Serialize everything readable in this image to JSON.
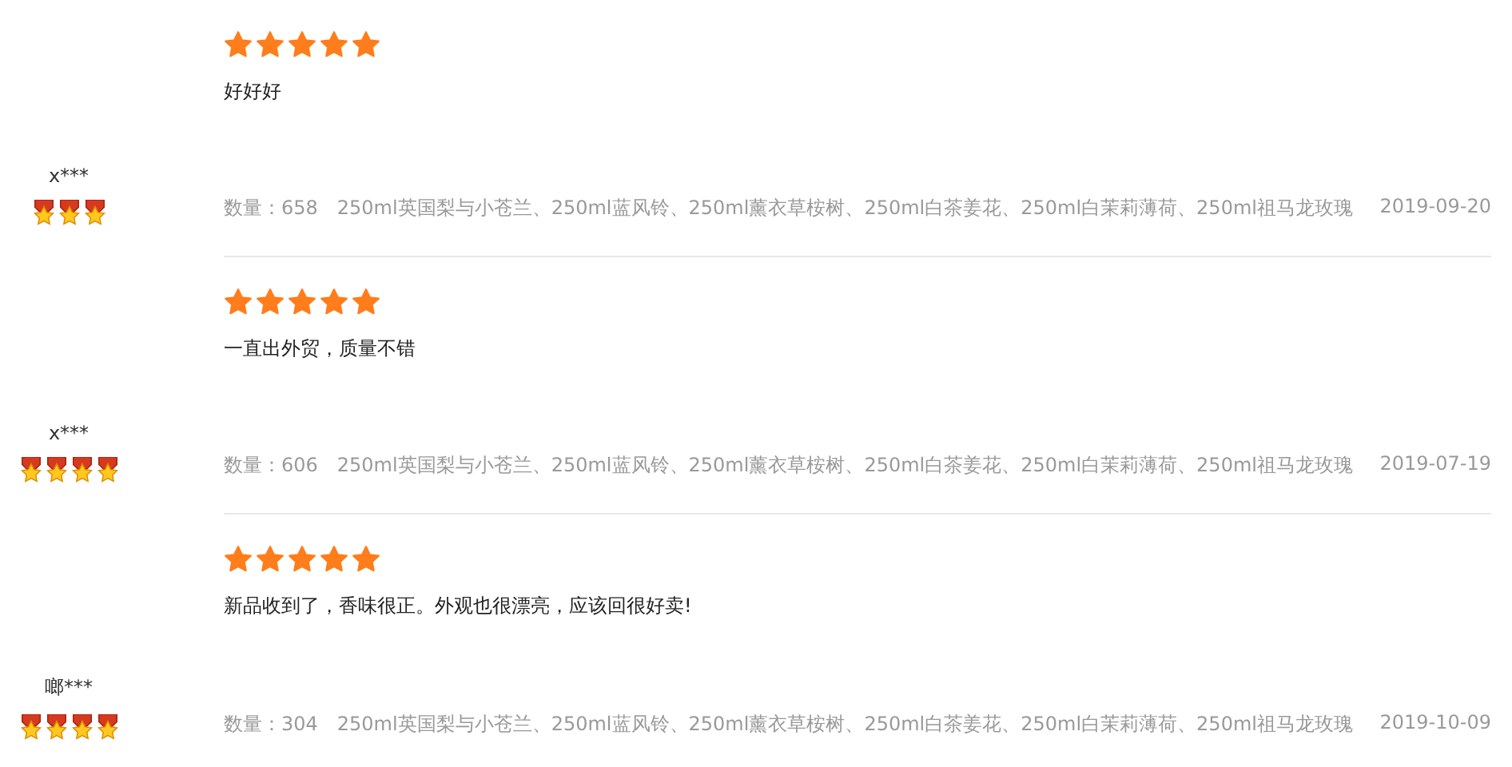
{
  "reviews": [
    {
      "user": {
        "name": "x***",
        "stars": 3
      },
      "rating": {
        "stars": 5
      },
      "comment": "好好好",
      "quantity": "数量：658",
      "specs": "250ml英国梨与小苍兰、250ml蓝风铃、250ml薰衣草桉树、250ml白茶姜花、250ml白茉莉薄荷、250ml祖马龙玫瑰",
      "date": "2019-09-20"
    },
    {
      "user": {
        "name": "x***",
        "stars": 4
      },
      "rating": {
        "stars": 5
      },
      "comment": "一直出外贸，质量不错",
      "quantity": "数量：606",
      "specs": "250ml英国梨与小苍兰、250ml蓝风铃、250ml薰衣草桉树、250ml白茶姜花、250ml白茉莉薄荷、250ml祖马龙玫瑰",
      "date": "2019-07-19"
    },
    {
      "user": {
        "name": "啷***",
        "stars": 4
      },
      "rating": {
        "stars": 5
      },
      "comment": "新品收到了，香味很正。外观也很漂亮，应该回很好卖!",
      "quantity": "数量：304",
      "specs": "250ml英国梨与小苍兰、250ml蓝风铃、250ml薰衣草桉树、250ml白茶姜花、250ml白茉莉薄荷、250ml祖马龙玫瑰",
      "date": "2019-10-09"
    }
  ]
}
